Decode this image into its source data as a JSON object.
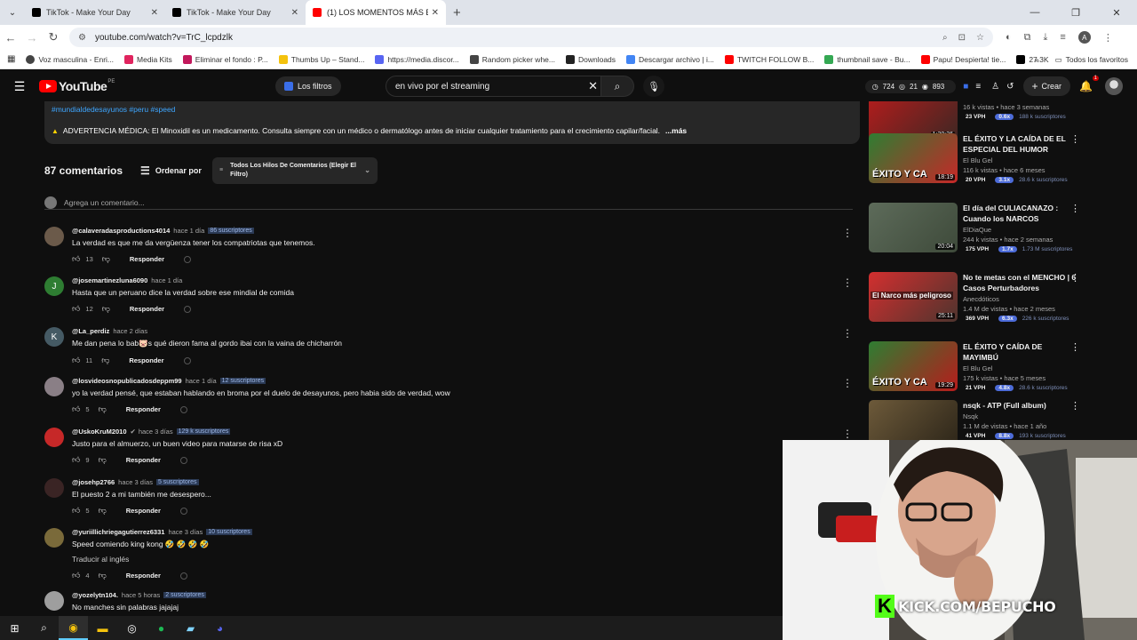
{
  "browser": {
    "tabs": [
      {
        "title": "TikTok - Make Your Day",
        "color": "#000000",
        "active": false
      },
      {
        "title": "TikTok - Make Your Day",
        "color": "#000000",
        "active": false
      },
      {
        "title": "(1) LOS MOMENTOS MÁS ESTU",
        "color": "#ff0000",
        "active": true
      }
    ],
    "url": "youtube.com/watch?v=TrC_lcpdzlk",
    "bookmarks": [
      {
        "label": "Voz masculina - Enri...",
        "color": "#444444"
      },
      {
        "label": "Media Kits",
        "color": "#e0245e"
      },
      {
        "label": "Eliminar el fondo : P...",
        "color": "#c2185b"
      },
      {
        "label": "Thumbs Up – Stand...",
        "color": "#f4c20d"
      },
      {
        "label": "https://media.discor...",
        "color": "#5865f2"
      },
      {
        "label": "Random picker whe...",
        "color": "#444444"
      },
      {
        "label": "Downloads",
        "color": "#222222"
      },
      {
        "label": "Descargar archivo | i...",
        "color": "#4285f4"
      },
      {
        "label": "TWITCH FOLLOW B...",
        "color": "#ff0000"
      },
      {
        "label": "thumbnail save - Bu...",
        "color": "#34a853"
      },
      {
        "label": "Papu! Despierta! tie...",
        "color": "#ff0000"
      },
      {
        "label": "27.3K",
        "color": "#000000"
      }
    ],
    "all_favorites": "Todos los favoritos"
  },
  "header": {
    "logo": "YouTube",
    "region": "PE",
    "filters_label": "Los filtros",
    "search_value": "en vivo por el streaming",
    "stats": [
      "724",
      "21",
      "893"
    ],
    "create_label": "Crear",
    "notif_count": "1"
  },
  "description": {
    "tags": "#mundialdedesayunos #peru #speed",
    "warning": "ADVERTENCIA MÉDICA: El Minoxidil es un medicamento. Consulta siempre con un médico o dermatólogo antes de iniciar cualquier tratamiento para el crecimiento capilar/facial.",
    "more": "...más"
  },
  "comments_header": {
    "count": "87 comentarios",
    "sort": "Ordenar por",
    "thread_select": "Todos Los Hilos De Comentarios (Elegir El Filtro)",
    "add_placeholder": "Agrega un comentario..."
  },
  "comments": [
    {
      "user": "@calaveradasproductions4014",
      "verified": false,
      "when": "hace 1 día",
      "subs": "86 suscriptores",
      "text": "La verdad es que me da vergüenza tener los compatriotas que tenemos.",
      "likes": "13",
      "avatar_color": "#6b5a4a",
      "avatar_letter": ""
    },
    {
      "user": "@josemartinezluna6090",
      "verified": false,
      "when": "hace 1 día",
      "subs": "",
      "text": "Hasta que un peruano dice la verdad sobre ese mindial de comida",
      "likes": "12",
      "avatar_color": "#2e7d32",
      "avatar_letter": "J"
    },
    {
      "user": "@La_perdiz",
      "verified": false,
      "when": "hace 2 días",
      "subs": "",
      "text": "Me dan pena lo bab🐷s qué dieron fama al gordo ibai con la vaina de chicharrón",
      "likes": "11",
      "avatar_color": "#455a64",
      "avatar_letter": "K"
    },
    {
      "user": "@losvideosnopublicadosdeppm99",
      "verified": false,
      "when": "hace 1 día",
      "subs": "12 suscriptores",
      "text": "yo la verdad pensé, que estaban hablando en broma por el duelo de desayunos, pero habia sido de verdad, wow",
      "likes": "5",
      "avatar_color": "#8a7f86",
      "avatar_letter": ""
    },
    {
      "user": "@UskoKruM2010",
      "verified": true,
      "when": "hace 3 días",
      "subs": "129 k suscriptores",
      "text": "Justo para el almuerzo, un buen video para matarse de risa xD",
      "likes": "9",
      "avatar_color": "#c62828",
      "avatar_letter": ""
    },
    {
      "user": "@josehp2766",
      "verified": false,
      "when": "hace 3 días",
      "subs": "5 suscriptores",
      "text": "El puesto 2 a mi también me desespero...",
      "likes": "5",
      "avatar_color": "#3a2424",
      "avatar_letter": ""
    },
    {
      "user": "@yuriillichriegagutierrez6331",
      "verified": false,
      "when": "hace 3 días",
      "subs": "10 suscriptores",
      "text": "Speed comiendo king kong 🤣 🤣 🤣 🤣",
      "translate": "Traducir al inglés",
      "likes": "4",
      "avatar_color": "#7a6a3a",
      "avatar_letter": ""
    },
    {
      "user": "@yozelytn104.",
      "verified": false,
      "when": "hace 5 horas",
      "subs": "2 suscriptores",
      "text": "No manches sin palabras jajajaj",
      "likes": "",
      "avatar_color": "#9e9e9e",
      "avatar_letter": ""
    }
  ],
  "sidebar": {
    "videos": [
      {
        "title": "",
        "channel": "",
        "meta": "16 k vistas • hace 3 semanas",
        "duration": "1:30:36",
        "vph": "23 VPH",
        "mult": "0.6x",
        "subs": "188 k suscriptores",
        "thumb_colors": [
          "#b71c1c",
          "#3e2723"
        ]
      },
      {
        "title": "EL ÉXITO Y LA CAÍDA DE EL ESPECIAL DEL HUMOR",
        "channel": "El Blu Gel",
        "meta": "116 k vistas • hace 6 meses",
        "duration": "18:19",
        "vph": "20 VPH",
        "mult": "3.1x",
        "subs": "28.6 k suscriptores",
        "thumb_colors": [
          "#2e7d32",
          "#c62828"
        ]
      },
      {
        "title": "El día del CULIACANAZO : Cuando los NARCOS venciero...",
        "channel": "ElDiaQue",
        "meta": "244 k vistas • hace 2 semanas",
        "duration": "20:04",
        "vph": "175 VPH",
        "mult": "1.7x",
        "subs": "1.73 M suscriptores",
        "thumb_colors": [
          "#5d6b5a",
          "#3e4a3a"
        ]
      },
      {
        "title": "No te metas con el MENCHO | 6 Casos Perturbadores",
        "channel": "Anecdóticos",
        "meta": "1.4 M de vistas • hace 2 meses",
        "duration": "25:11",
        "vph": "369 VPH",
        "mult": "6.3x",
        "subs": "226 k suscriptores",
        "thumb_colors": [
          "#d32f2f",
          "#4e342e"
        ]
      },
      {
        "title": "EL ÉXITO Y CAÍDA DE MAYIMBÚ",
        "channel": "El Blu Gel",
        "meta": "175 k vistas • hace 5 meses",
        "duration": "19:29",
        "vph": "21 VPH",
        "mult": "4.8x",
        "subs": "28.6 k suscriptores",
        "thumb_colors": [
          "#2e7d32",
          "#b71c1c"
        ]
      },
      {
        "title": "nsqk - ATP (Full album)",
        "channel": "Nsqk",
        "meta": "1.1 M de vistas • hace 1 año",
        "duration": "",
        "vph": "41 VPH",
        "mult": "8.8x",
        "subs": "193 k suscriptores",
        "thumb_colors": [
          "#6d5a3a",
          "#2b2418"
        ]
      }
    ],
    "thumb_texts": {
      "exito": "ÉXITO Y CA",
      "narco": "El Narco más peligroso"
    }
  },
  "overlay": {
    "kick_text": "KICK.COM/BEPUCHO",
    "kick_color": "#53fc18"
  }
}
